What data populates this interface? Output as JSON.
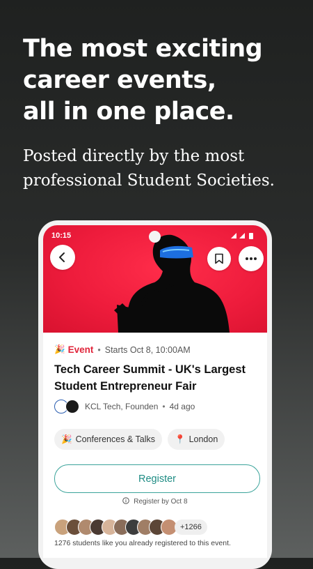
{
  "headline": {
    "line1": "The most exciting",
    "line2": "career events,",
    "line3": "all in one place."
  },
  "subheadline": {
    "line1": "Posted directly by the most",
    "line2": "professional Student Societies."
  },
  "status_bar": {
    "time": "10:15"
  },
  "event": {
    "emoji": "🎉",
    "label": "Event",
    "start": "Starts Oct 8, 10:00AM",
    "title_line1": "Tech Career Summit - UK's Largest",
    "title_line2": "Student Entrepreneur Fair",
    "organizers": "KCL Tech, Founden",
    "posted": "4d ago",
    "tags": [
      {
        "emoji": "🎉",
        "label": "Conferences & Talks"
      },
      {
        "emoji": "📍",
        "label": "London"
      }
    ],
    "register_label": "Register",
    "register_deadline": "Register by Oct 8",
    "attendee_extra": "+1266",
    "attendees_text": "1276 students like you already registered to this event."
  },
  "colors": {
    "accent_red": "#e0243a",
    "register_teal": "#3aa39a",
    "hero_red": "#ee1c3c"
  },
  "icons": {
    "back": "chevron-left-icon",
    "bookmark": "bookmark-icon",
    "more": "more-horizontal-icon",
    "info": "info-icon"
  }
}
